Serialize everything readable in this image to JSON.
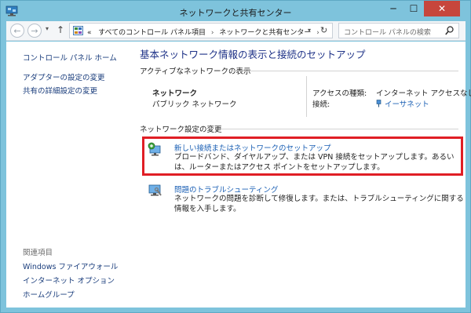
{
  "window": {
    "title": "ネットワークと共有センター",
    "minimize": "─",
    "maximize": "☐",
    "close": "✕",
    "close_color": "#c7463c"
  },
  "navbar": {
    "back": "←",
    "forward": "→",
    "dropdown": "▾",
    "up": "↑",
    "address": {
      "prefix": "«",
      "crumbs": [
        "すべてのコントロール パネル項目",
        "ネットワークと共有センター"
      ],
      "separator": "›",
      "refresh": "↻"
    },
    "search": {
      "placeholder": "コントロール パネルの検索"
    }
  },
  "sidebar": {
    "home": "コントロール パネル ホーム",
    "links": [
      "アダプターの設定の変更",
      "共有の詳細設定の変更"
    ],
    "related_heading": "関連項目",
    "related": [
      "Windows ファイアウォール",
      "インターネット オプション",
      "ホームグループ"
    ]
  },
  "main": {
    "title": "基本ネットワーク情報の表示と接続のセットアップ",
    "active_heading": "アクティブなネットワークの表示",
    "network": {
      "name": "ネットワーク",
      "type": "パブリック ネットワーク",
      "access_label": "アクセスの種類:",
      "access_value": "インターネット アクセスなし",
      "connection_label": "接続:",
      "connection_value": "イーサネット"
    },
    "change_heading": "ネットワーク設定の変更",
    "tasks": [
      {
        "title": "新しい接続またはネットワークのセットアップ",
        "desc": "ブロードバンド、ダイヤルアップ、または VPN 接続をセットアップします。あるいは、ルーターまたはアクセス ポイントをセットアップします。"
      },
      {
        "title": "問題のトラブルシューティング",
        "desc": "ネットワークの問題を診断して修復します。または、トラブルシューティングに関する情報を入手します。"
      }
    ]
  },
  "colors": {
    "frame": "#7ec3dc",
    "link": "#1a5fb4",
    "title": "#1e3287",
    "highlight": "#e01e25"
  }
}
